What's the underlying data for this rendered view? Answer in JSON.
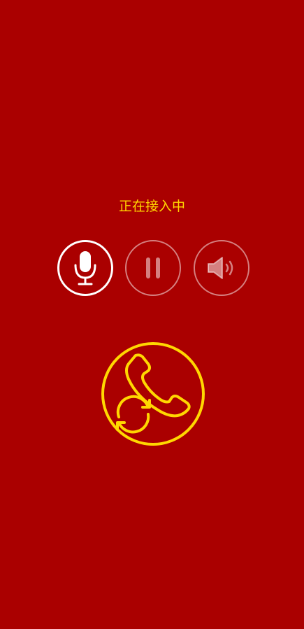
{
  "call": {
    "status_text": "正在接入中"
  },
  "controls": [
    {
      "icon": "microphone-icon",
      "state": "active"
    },
    {
      "icon": "pause-icon",
      "state": "disabled"
    },
    {
      "icon": "speaker-icon",
      "state": "disabled"
    }
  ],
  "answer_button": {
    "icon": "phone-transfer-icon"
  },
  "colors": {
    "background": "#AA0000",
    "accent": "#FFD700",
    "active_control": "#FFFFFF",
    "disabled_control": "rgba(255,255,255,0.5)"
  }
}
